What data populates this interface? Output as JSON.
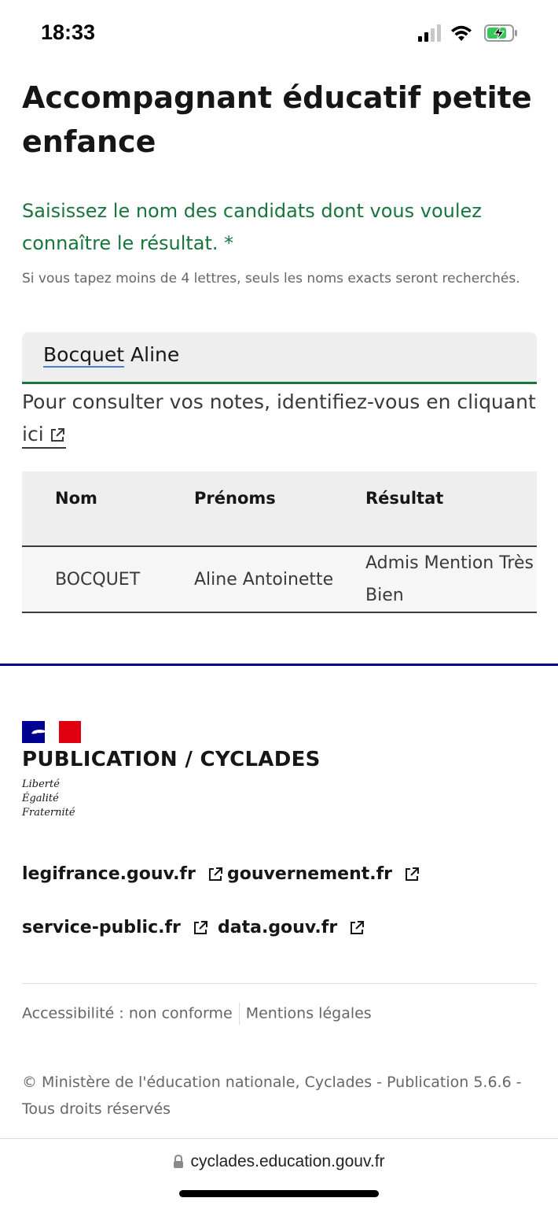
{
  "status_bar": {
    "time": "18:33",
    "icons": [
      "signal-icon",
      "wifi-icon",
      "battery-charging-icon"
    ]
  },
  "page": {
    "title": "Accompagnant éducatif petite enfance"
  },
  "search": {
    "label": "Saisissez le nom des candidats dont vous voulez connaître le résultat. *",
    "hint": "Si vous tapez moins de 4 lettres, seuls les noms exacts seront recherchés.",
    "value_first_word": "Bocquet",
    "value_rest": " Aline"
  },
  "notes": {
    "text": "Pour consulter vos notes, identifiez-vous en cliquant ",
    "link_label": "ici"
  },
  "table": {
    "headers": [
      "Nom",
      "Prénoms",
      "Résultat"
    ],
    "rows": [
      [
        "BOCQUET",
        "Aline Antoinette",
        "Admis Mention Très Bien"
      ]
    ]
  },
  "footer": {
    "brand": "PUBLICATION / CYCLADES",
    "motto": [
      "Liberté",
      "Égalité",
      "Fraternité"
    ],
    "links": [
      "legifrance.gouv.fr",
      "gouvernement.fr",
      "service-public.fr",
      "data.gouv.fr"
    ],
    "bottom_links": [
      "Accessibilité : non conforme",
      "Mentions légales"
    ],
    "copyright": "© Ministère de l'éducation nationale, Cyclades - Publication 5.6.6 - Tous droits réservés"
  },
  "browser": {
    "url": "cyclades.education.gouv.fr"
  },
  "colors": {
    "accent_green": "#18753c",
    "marianne_blue": "#000091",
    "marianne_red": "#e1000f"
  }
}
